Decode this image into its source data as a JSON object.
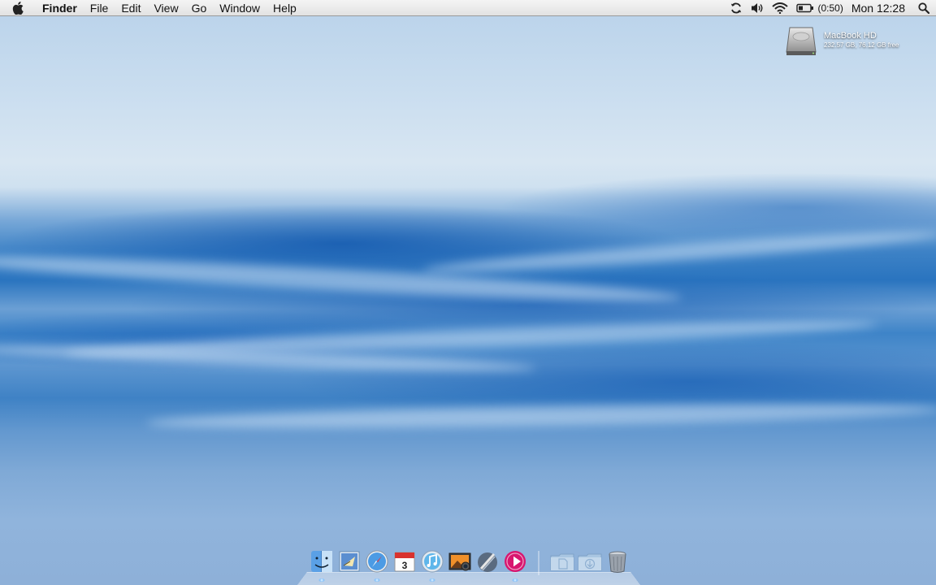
{
  "menubar": {
    "apple_icon": "apple-icon",
    "items": [
      "Finder",
      "File",
      "Edit",
      "View",
      "Go",
      "Window",
      "Help"
    ],
    "status": {
      "sync_icon": "sync-icon",
      "volume_icon": "volume-icon",
      "wifi_icon": "wifi-icon",
      "battery_icon": "battery-icon",
      "battery_text": "(0:50)",
      "clock": "Mon 12:28",
      "spotlight_icon": "spotlight-icon"
    }
  },
  "desktop": {
    "drive": {
      "name": "MacBook HD",
      "info": "232.57 GB, 76.12 GB free"
    }
  },
  "dock": {
    "apps": [
      {
        "name": "Finder",
        "icon": "finder-icon",
        "running": true
      },
      {
        "name": "Mail",
        "icon": "mail-icon",
        "running": false
      },
      {
        "name": "Safari",
        "icon": "safari-icon",
        "running": true
      },
      {
        "name": "iCal",
        "icon": "ical-icon",
        "running": false,
        "badge": "3"
      },
      {
        "name": "iTunes",
        "icon": "itunes-icon",
        "running": true
      },
      {
        "name": "iPhoto",
        "icon": "iphoto-icon",
        "running": false
      },
      {
        "name": "Script Editor",
        "icon": "script-editor-icon",
        "running": false
      },
      {
        "name": "Media Player",
        "icon": "media-player-icon",
        "running": true
      }
    ],
    "folders": [
      {
        "name": "Documents",
        "icon": "documents-folder-icon"
      },
      {
        "name": "Downloads",
        "icon": "downloads-folder-icon"
      },
      {
        "name": "Trash",
        "icon": "trash-icon"
      }
    ]
  }
}
